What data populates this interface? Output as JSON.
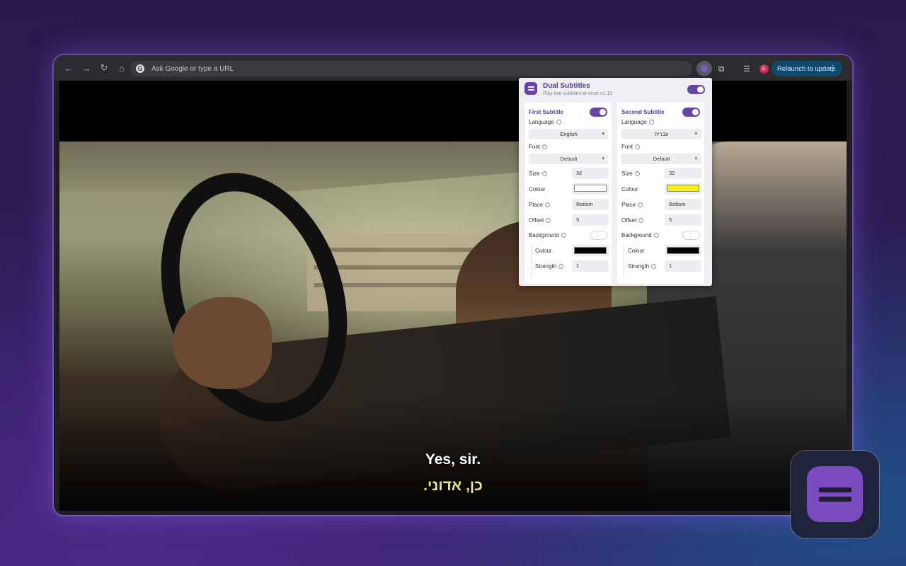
{
  "browser": {
    "omnibox_placeholder": "Ask Google or type a URL",
    "omnibox_icon": "G",
    "profile_initial": "G",
    "relaunch_label": "Relaunch to update"
  },
  "video": {
    "subtitle_primary": "Yes, sir.",
    "subtitle_secondary": "כן, אדוני."
  },
  "popup": {
    "title": "Dual Subtitles",
    "subtitle": "Play two subtitles at once",
    "version": "v1.15",
    "enabled": true,
    "first": {
      "heading": "First Subtitle",
      "enabled": true,
      "language_label": "Language",
      "language_value": "English",
      "font_label": "Font",
      "font_value": "Default",
      "size_label": "Size",
      "size_value": "32",
      "colour_label": "Colour",
      "colour_value": "#ffffff",
      "place_label": "Place",
      "place_value": "Bottom",
      "offset_label": "Offset",
      "offset_value": "5",
      "background_label": "Background",
      "background_enabled": false,
      "bg_colour_label": "Colour",
      "bg_colour_value": "#000000",
      "strength_label": "Strength",
      "strength_value": "1"
    },
    "second": {
      "heading": "Second Subtitle",
      "enabled": true,
      "language_label": "Language",
      "language_value": "עברית",
      "font_label": "Font",
      "font_value": "Default",
      "size_label": "Size",
      "size_value": "32",
      "colour_label": "Colour",
      "colour_value": "#f2ee1c",
      "place_label": "Place",
      "place_value": "Bottom",
      "offset_label": "Offset",
      "offset_value": "5",
      "background_label": "Background",
      "background_enabled": false,
      "bg_colour_label": "Colour",
      "bg_colour_value": "#000000",
      "strength_label": "Strength",
      "strength_value": "1"
    }
  },
  "colors": {
    "accent": "#6a43a8",
    "secondary_subtitle": "#ece38a"
  }
}
